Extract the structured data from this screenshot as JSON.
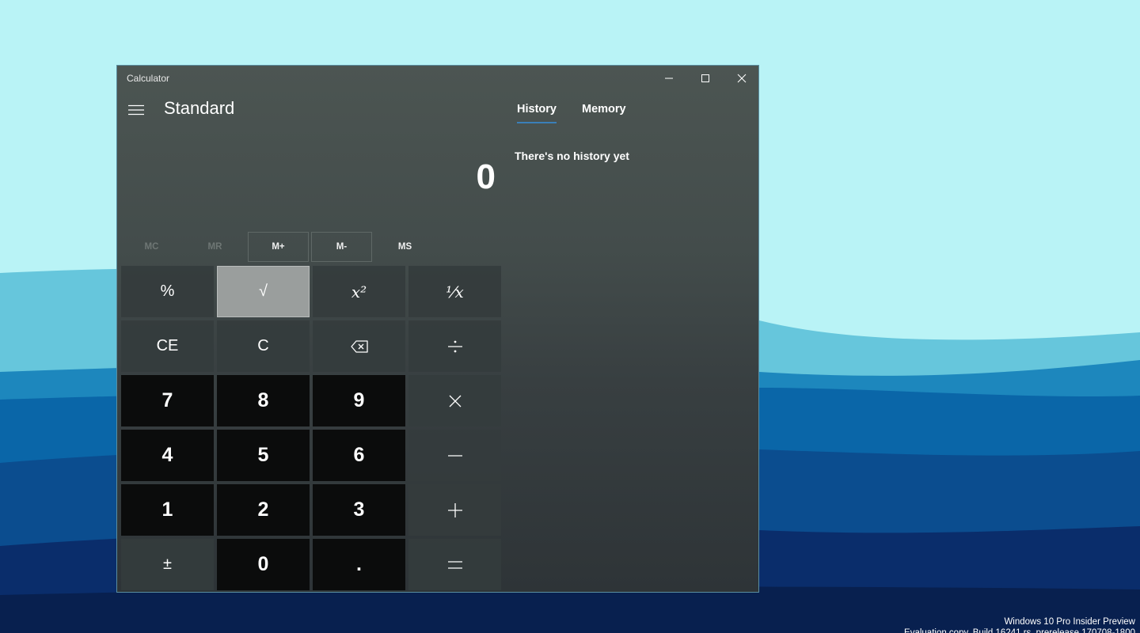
{
  "window": {
    "title": "Calculator",
    "mode": "Standard"
  },
  "display": {
    "value": "0"
  },
  "memory": [
    "MC",
    "MR",
    "M+",
    "M-",
    "MS"
  ],
  "keys": {
    "percent": "%",
    "sqrt": "√",
    "square": "x²",
    "reciprocal": "¹⁄x",
    "ce": "CE",
    "c": "C",
    "d7": "7",
    "d8": "8",
    "d9": "9",
    "d4": "4",
    "d5": "5",
    "d6": "6",
    "d1": "1",
    "d2": "2",
    "d3": "3",
    "negate": "±",
    "d0": "0",
    "decimal": "."
  },
  "panel": {
    "tabs": [
      "History",
      "Memory"
    ],
    "empty_message": "There's no history yet"
  },
  "watermark": {
    "line1": "Windows 10 Pro Insider Preview",
    "line2": "Evaluation copy. Build 16241.rs_prerelease.170708-1800"
  },
  "colors": {
    "accent": "#3a7fb8",
    "highlight_key": "#9a9e9d",
    "number_key": "#0b0c0c",
    "function_key": "#343c3d"
  }
}
